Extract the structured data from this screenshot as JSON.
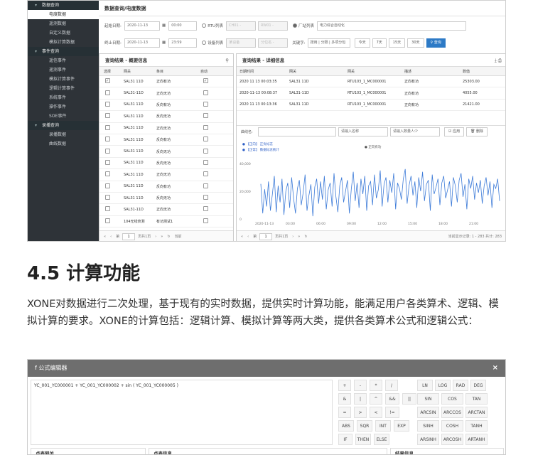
{
  "sidebar": {
    "groups": [
      {
        "label": "数据查询",
        "items": [
          "电度数据",
          "遥测数据",
          "自定义数据",
          "模拟计算数据"
        ]
      },
      {
        "label": "事件查询",
        "items": [
          "遥信事件",
          "遥测事件",
          "模拟计算事件",
          "逻辑计算事件",
          "系统事件",
          "操作事件",
          "SOE事件"
        ]
      },
      {
        "label": "录播查询",
        "items": [
          "录播数据",
          "曲线数据"
        ]
      }
    ],
    "active_item": "电度数据"
  },
  "main": {
    "title": "数据查询/电度数据",
    "filters": {
      "start_label": "起始日期:",
      "start_date": "2020-11-13",
      "start_time": "00:00",
      "end_label": "终止日期:",
      "end_date": "2020-11-13",
      "end_time": "23:59",
      "rtu_radio": "RTU列表",
      "rtu_sel1": "CH01 -",
      "rtu_sel2": "RW01 -",
      "dev_radio": "设备列表",
      "dev_sel1": "某设备",
      "dev_sel2": "分位名 -",
      "plant_radio": "厂站列表",
      "plant_select": "电力综合自动化",
      "keyword_label": "关键字:",
      "keyword_placeholder": "按用 | 分隔 | 多项分包",
      "btn_today": "今天",
      "btn_7": "7天",
      "btn_15": "15天",
      "btn_30": "30天",
      "btn_query": "查询"
    },
    "left_panel": {
      "title": "查询结果 - 概要信息",
      "columns": [
        "选择",
        "网关",
        "条目",
        "自动"
      ],
      "rows": [
        [
          "SAL31 11D",
          "正向有功"
        ],
        [
          "SAL31-11D",
          "正向无功"
        ],
        [
          "SAL31 11D",
          "反向有功"
        ],
        [
          "SAL31 11D",
          "反向无功"
        ],
        [
          "SAL31 11D",
          "正向无功"
        ],
        [
          "SAL31 11D",
          "反向有功"
        ],
        [
          "SAL31 11D",
          "反向无功"
        ],
        [
          "SAL31 11D",
          "反向无功"
        ],
        [
          "SAL31 11D",
          "正向无功"
        ],
        [
          "SAL31 11D",
          "反向有功"
        ],
        [
          "SAL31 11D",
          "反向无功"
        ],
        [
          "SAL31-11D",
          "正向无功"
        ],
        [
          "104无线侦测",
          "有功测试1"
        ]
      ],
      "pager": {
        "page_label": "第",
        "page_value": "1",
        "total": "页共1页",
        "suffix": "当前"
      }
    },
    "right_panel": {
      "title": "查询结果 - 详细信息",
      "columns": [
        "日期时间",
        "网关",
        "网关",
        "描述",
        "数值"
      ],
      "rows": [
        [
          "2020 11 13 00:03:35",
          "SAL31 11D",
          "RTU103_1_MC000001",
          "正向有功",
          "25303.00"
        ],
        [
          "2020-11-13 00:08:37",
          "SAL31-11D",
          "RTU103_1_MC000001",
          "正向有功",
          "4055.00"
        ],
        [
          "2020 11 13 00:13:36",
          "SAL31 11D",
          "RTU103_1_MC000001",
          "正向有功",
          "21421.00"
        ]
      ],
      "chart_toolbar": {
        "select_label": "曲线名:",
        "search_placeholder": "请输入名称",
        "count_placeholder": "请输入数量人少",
        "apply_label": "应用",
        "delete_label": "删除"
      },
      "pager": {
        "page_label": "第",
        "page_value": "1",
        "total": "页共1页",
        "record_info": "当前显示记录: 1 - 283 共计: 283"
      }
    }
  },
  "chart_data": {
    "type": "line",
    "legend": [
      "【正向】 正负标志",
      "【正常】 数据标志统计",
      "正向有功"
    ],
    "x_ticks": [
      "2020-11-13",
      "03:00",
      "06:00",
      "09:00",
      "12:00",
      "15:00",
      "18:00",
      "21:00"
    ],
    "y_ticks": [
      0,
      20000,
      40000
    ],
    "ylim": [
      0,
      40000
    ],
    "series": [
      {
        "name": "正向有功",
        "color": "#3d7bd8",
        "values": [
          25303,
          4055,
          21421,
          9000,
          27000,
          6000,
          18000,
          31000,
          5000,
          24000,
          12000,
          29000,
          3000,
          20000,
          26000,
          8000,
          30000,
          15000,
          4000,
          22000,
          28000,
          10000,
          19000,
          32000,
          6000,
          17000,
          25000,
          2000,
          23000,
          29000,
          11000,
          27000,
          14000,
          31000,
          7000,
          21000,
          26000,
          9000,
          33000,
          16000,
          5000,
          24000,
          30000,
          12000,
          20000,
          28000,
          4000,
          22000,
          34000,
          13000,
          26000,
          8000,
          29000,
          18000,
          31000,
          6000,
          24000,
          27000,
          10000,
          32000,
          15000,
          21000,
          35000,
          9000,
          25000,
          30000,
          12000,
          28000,
          19000,
          33000,
          7000,
          26000,
          22000,
          14000,
          29000,
          36000,
          11000,
          24000,
          31000,
          17000,
          27000,
          8000,
          30000,
          20000,
          34000,
          13000,
          25000,
          28000,
          6000,
          32000,
          18000,
          23000,
          29000,
          10000,
          26000,
          31000,
          15000,
          21000,
          27000,
          9000,
          30000,
          24000,
          12000,
          28000,
          33000,
          16000,
          25000,
          7000,
          29000,
          22000,
          31000,
          14000,
          26000,
          19000,
          28000,
          11000,
          24000,
          30000,
          17000,
          27000,
          8000,
          25000,
          22000,
          29000,
          13000
        ]
      }
    ]
  },
  "section": {
    "heading": "4.5 计算功能",
    "paragraph": "XONE对数据进行二次处理，基于现有的实时数据，提供实时计算功能，能满足用户各类算术、逻辑、模拟计算的要求。XONE的计算包括：逻辑计算、模拟计算等两大类，提供各类算术公式和逻辑公式："
  },
  "formula_editor": {
    "title": "f  公式编辑器",
    "close": "×",
    "expression": "YC_001_YC000001 + YC_001_YC000002 + sin ( YC_001_YC000005 )",
    "operators": [
      [
        "+",
        "-",
        "*",
        "/"
      ],
      [
        "&",
        "|",
        "^",
        "&&",
        "||"
      ],
      [
        "=",
        ">",
        "<",
        "!="
      ],
      [
        "ABS",
        "SQR",
        "INT",
        "EXP"
      ],
      [
        "IF",
        "THEN",
        "ELSE"
      ]
    ],
    "functions": [
      [
        "LN",
        "LOG",
        "RAD",
        "DEG"
      ],
      [
        "SIN",
        "COS",
        "TAN"
      ],
      [
        "ARCSIN",
        "ARCCOS",
        "ARCTAN"
      ],
      [
        "SINH",
        "COSH",
        "TANH"
      ],
      [
        "ARSINH",
        "ARCOSH",
        "ARTANH"
      ]
    ],
    "bottom_labels": [
      "点表网关",
      "点表信息",
      "结果信息"
    ]
  }
}
